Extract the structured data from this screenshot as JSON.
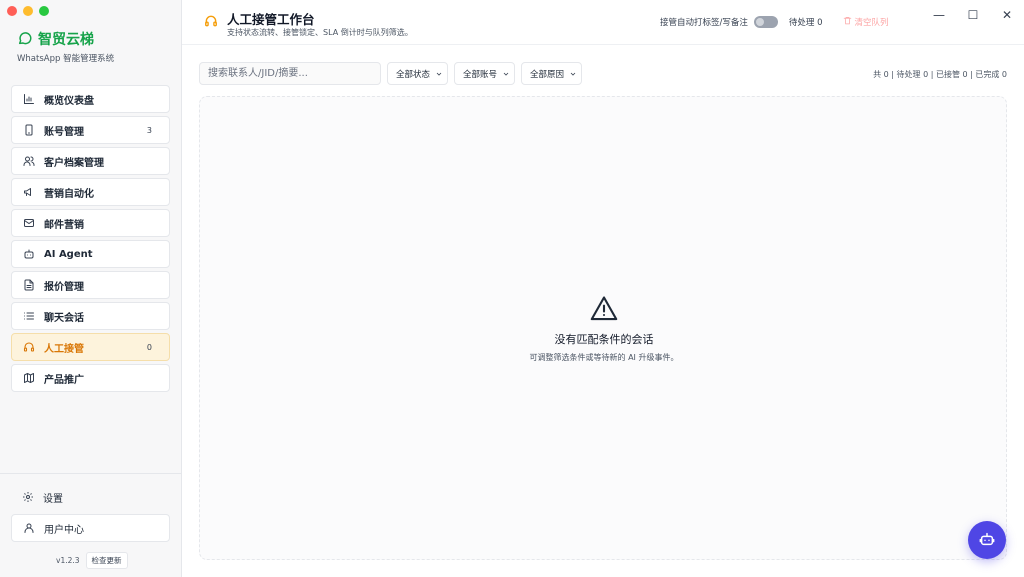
{
  "brand": {
    "name": "智贸云梯",
    "subtitle": "WhatsApp 智能管理系统"
  },
  "sidebar": {
    "items": [
      {
        "label": "概览仪表盘",
        "icon": "bar-chart-icon",
        "badge": ""
      },
      {
        "label": "账号管理",
        "icon": "phone-icon",
        "badge": "3"
      },
      {
        "label": "客户档案管理",
        "icon": "users-icon",
        "badge": ""
      },
      {
        "label": "营销自动化",
        "icon": "megaphone-icon",
        "badge": ""
      },
      {
        "label": "邮件营销",
        "icon": "mail-icon",
        "badge": ""
      },
      {
        "label": "AI Agent",
        "icon": "bot-icon",
        "badge": ""
      },
      {
        "label": "报价管理",
        "icon": "document-icon",
        "badge": ""
      },
      {
        "label": "聊天会话",
        "icon": "list-icon",
        "badge": ""
      },
      {
        "label": "人工接管",
        "icon": "headset-icon",
        "badge": "0",
        "active": true
      },
      {
        "label": "产品推广",
        "icon": "map-icon",
        "badge": ""
      }
    ],
    "settings_label": "设置",
    "user_center_label": "用户中心",
    "version": "v1.2.3",
    "check_update_label": "检查更新"
  },
  "header": {
    "title": "人工接管工作台",
    "subtitle": "支持状态流转、接管锁定、SLA 倒计时与队列筛选。",
    "auto_tag_label": "接管自动打标签/写备注",
    "pending_label": "待处理 0",
    "clear_queue_label": "清空队列"
  },
  "toolbar": {
    "search_placeholder": "搜索联系人/JID/摘要...",
    "status_select": "全部状态",
    "account_select": "全部账号",
    "reason_select": "全部原因",
    "counts": "共 0 | 待处理 0 | 已接管 0 | 已完成 0"
  },
  "empty_state": {
    "title": "没有匹配条件的会话",
    "description": "可调整筛选条件或等待新的 AI 升级事件。"
  },
  "colors": {
    "brand_green": "#16a34a",
    "active_bg": "#fdf3dc",
    "active_text": "#d97706",
    "fab": "#4f46e5",
    "danger_light": "#fca5a5"
  }
}
